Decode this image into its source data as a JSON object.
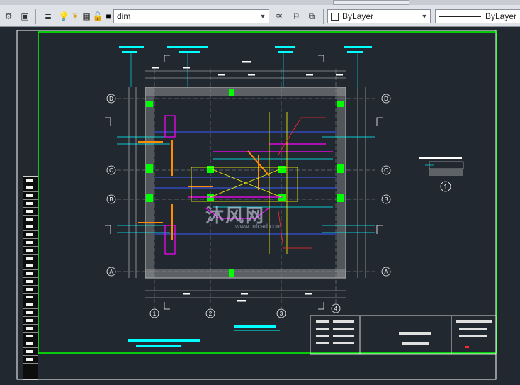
{
  "toolbar": {
    "layer_name": "dim",
    "color_value": "ByLayer",
    "linetype_value": "ByLayer"
  },
  "drawing": {
    "grid_rows": [
      "D",
      "C",
      "B",
      "A"
    ],
    "grid_cols": [
      "1",
      "2",
      "3",
      "4"
    ],
    "section_mark": "1",
    "watermark": "沐风网",
    "watermark_url": "www.mfcad.com"
  },
  "colors": {
    "background": "#212830",
    "frame": "#00ff00",
    "axis_text": "#ffffff",
    "cyan": "#00ffff",
    "magenta": "#ff00ff",
    "orange": "#ff8c00",
    "wall": "#c8c8c8",
    "column": "#00ff00",
    "yellow": "#ffff00",
    "blue": "#2a2aff",
    "red": "#ff2a2a"
  }
}
